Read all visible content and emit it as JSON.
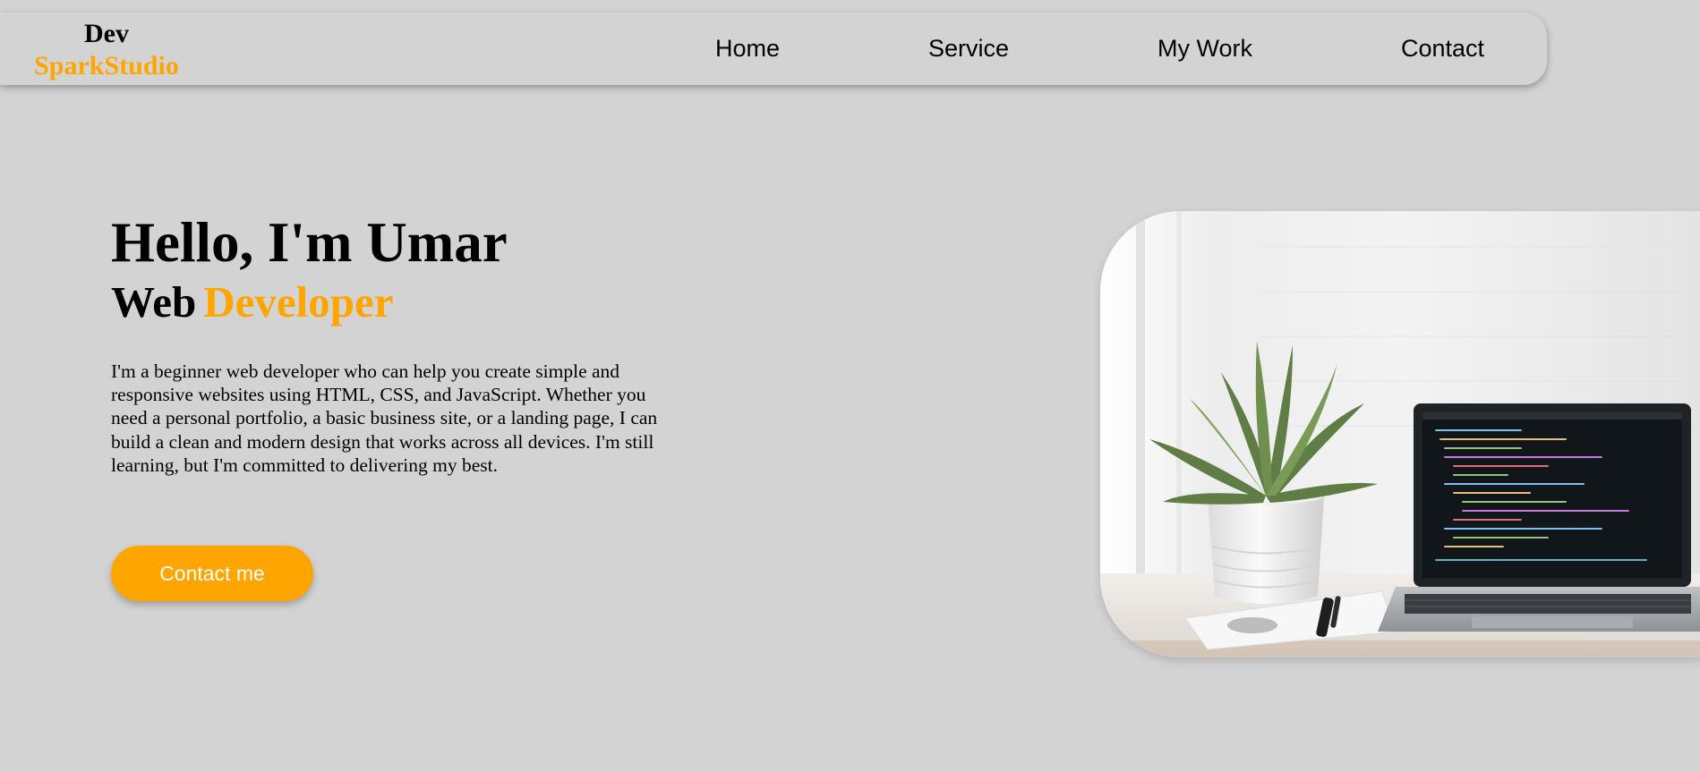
{
  "logo": {
    "line1": "Dev",
    "line2": "SparkStudio"
  },
  "nav": {
    "items": [
      {
        "label": "Home"
      },
      {
        "label": "Service"
      },
      {
        "label": "My Work"
      },
      {
        "label": "Contact"
      }
    ]
  },
  "hero": {
    "greeting": "Hello, I'm Umar",
    "role_prefix": "Web",
    "role_accent": "Developer",
    "description": "I'm a beginner web developer who can help you create simple and responsive websites using HTML, CSS, and JavaScript. Whether you need a personal portfolio, a basic business site, or a landing page, I can build a clean and modern design that works across all devices. I'm still learning, but I'm committed to delivering my best.",
    "cta_label": "Contact me"
  },
  "colors": {
    "background": "#d3d3d3",
    "accent": "#ffa500",
    "text": "#000000",
    "button_text": "#ffffff"
  },
  "hero_image": {
    "subject": "plant-and-laptop-with-code"
  }
}
